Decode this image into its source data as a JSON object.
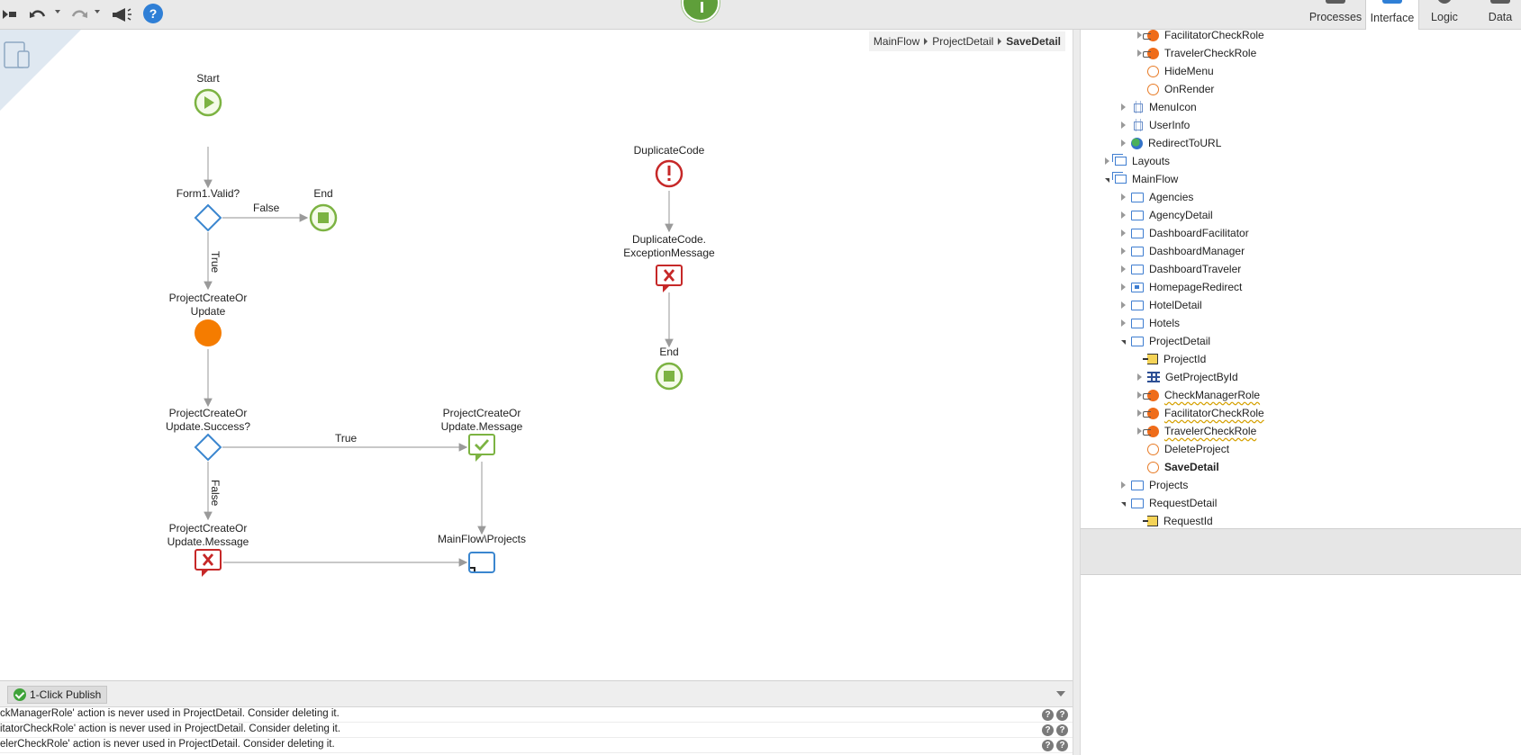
{
  "toolbar": {
    "icons": [
      "merge-icon",
      "undo-icon",
      "redo-icon",
      "megaphone-icon",
      "help-icon"
    ],
    "help_label": "?",
    "tabs": [
      {
        "label": "Processes",
        "active": false
      },
      {
        "label": "Interface",
        "active": true
      },
      {
        "label": "Logic",
        "active": false
      },
      {
        "label": "Data",
        "active": false
      }
    ]
  },
  "breadcrumb": {
    "items": [
      "MainFlow",
      "ProjectDetail"
    ],
    "current": "SaveDetail"
  },
  "flow": {
    "nodes": {
      "start": "Start",
      "valid": "Form1.Valid?",
      "end1": "End",
      "create1": "ProjectCreateOr",
      "create2": "Update",
      "success1": "ProjectCreateOr",
      "success2": "Update.Success?",
      "msgok1": "ProjectCreateOr",
      "msgok2": "Update.Message",
      "msgerr1": "ProjectCreateOr",
      "msgerr2": "Update.Message",
      "dest": "MainFlow\\Projects",
      "dup": "DuplicateCode",
      "dupmsg1": "DuplicateCode.",
      "dupmsg2": "ExceptionMessage",
      "end2": "End"
    },
    "edges": {
      "false1": "False",
      "true1": "True",
      "true2": "True",
      "false2": "False"
    }
  },
  "tree": [
    {
      "label": "FacilitatorCheckRole",
      "icon": "role-icon",
      "arrow": "collapsed",
      "wavy": false
    },
    {
      "label": "TravelerCheckRole",
      "icon": "role-icon",
      "arrow": "collapsed",
      "wavy": false
    },
    {
      "label": "HideMenu",
      "icon": "action-icon",
      "arrow": "none",
      "wavy": false
    },
    {
      "label": "OnRender",
      "icon": "action-icon",
      "arrow": "none",
      "wavy": false
    },
    {
      "label": "MenuIcon",
      "icon": "block-icon",
      "arrow": "collapsed",
      "wavy": false
    },
    {
      "label": "UserInfo",
      "icon": "block-icon",
      "arrow": "collapsed",
      "wavy": false
    },
    {
      "label": "RedirectToURL",
      "icon": "globe-icon",
      "arrow": "collapsed",
      "wavy": false
    },
    {
      "label": "Layouts",
      "icon": "flow-icon",
      "arrow": "collapsed",
      "wavy": false
    },
    {
      "label": "MainFlow",
      "icon": "flow-icon",
      "arrow": "expanded",
      "wavy": false
    },
    {
      "label": "Agencies",
      "icon": "screen-icon",
      "arrow": "collapsed",
      "wavy": false
    },
    {
      "label": "AgencyDetail",
      "icon": "screen-icon",
      "arrow": "collapsed",
      "wavy": false
    },
    {
      "label": "DashboardFacilitator",
      "icon": "screen-icon",
      "arrow": "collapsed",
      "wavy": false
    },
    {
      "label": "DashboardManager",
      "icon": "screen-icon",
      "arrow": "collapsed",
      "wavy": false
    },
    {
      "label": "DashboardTraveler",
      "icon": "screen-icon",
      "arrow": "collapsed",
      "wavy": false
    },
    {
      "label": "HomepageRedirect",
      "icon": "home-screen-icon",
      "arrow": "collapsed",
      "wavy": false
    },
    {
      "label": "HotelDetail",
      "icon": "screen-icon",
      "arrow": "collapsed",
      "wavy": false
    },
    {
      "label": "Hotels",
      "icon": "screen-icon",
      "arrow": "collapsed",
      "wavy": false
    },
    {
      "label": "ProjectDetail",
      "icon": "screen-icon",
      "arrow": "expanded",
      "wavy": false
    },
    {
      "label": "ProjectId",
      "icon": "input-parameter-icon",
      "arrow": "none",
      "wavy": false
    },
    {
      "label": "GetProjectById",
      "icon": "aggregate-icon",
      "arrow": "collapsed",
      "wavy": false
    },
    {
      "label": "CheckManagerRole",
      "icon": "role-icon",
      "arrow": "collapsed",
      "wavy": true
    },
    {
      "label": "FacilitatorCheckRole",
      "icon": "role-icon",
      "arrow": "collapsed",
      "wavy": true
    },
    {
      "label": "TravelerCheckRole",
      "icon": "role-icon",
      "arrow": "collapsed",
      "wavy": true
    },
    {
      "label": "DeleteProject",
      "icon": "action-icon",
      "arrow": "none",
      "wavy": false
    },
    {
      "label": "SaveDetail",
      "icon": "action-icon",
      "arrow": "none",
      "wavy": false,
      "selected": true
    },
    {
      "label": "Projects",
      "icon": "screen-icon",
      "arrow": "collapsed",
      "wavy": false
    },
    {
      "label": "RequestDetail",
      "icon": "screen-icon",
      "arrow": "expanded",
      "wavy": false
    },
    {
      "label": "RequestId",
      "icon": "input-parameter-icon",
      "arrow": "none",
      "wavy": false
    }
  ],
  "bottom": {
    "publish_tab": "1-Click Publish",
    "messages": [
      "ckManagerRole' action is never used in ProjectDetail. Consider deleting it.",
      "itatorCheckRole' action is never used in ProjectDetail. Consider deleting it.",
      "elerCheckRole' action is never used in ProjectDetail. Consider deleting it."
    ]
  },
  "colors": {
    "accent": "#2f7fd6",
    "start_green": "#8bc34a",
    "orange_action": "#f57c00",
    "error_red": "#c62828",
    "if_blue": "#3a86cf"
  }
}
